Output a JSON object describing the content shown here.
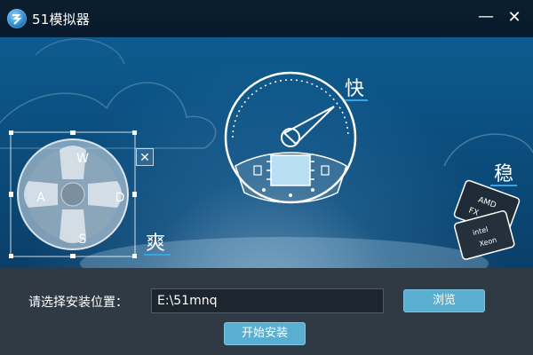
{
  "window": {
    "title": "51模拟器",
    "minimize_glyph": "—",
    "close_glyph": "✕"
  },
  "banner": {
    "feature_fast": "快",
    "feature_stable": "稳",
    "feature_cool": "爽",
    "dpad": {
      "up": "W",
      "left": "A",
      "right": "D",
      "down": "S",
      "close_glyph": "✕"
    },
    "chip_labels": [
      "AMD",
      "FX",
      "intel",
      "Xeon"
    ]
  },
  "install": {
    "path_label": "请选择安装位置：",
    "path_value": "E:\\51mnq",
    "browse_label": "浏览",
    "start_label": "开始安装"
  },
  "colors": {
    "titlebar": "#07192a",
    "banner_top": "#0e5b8f",
    "panel": "#2f3a44",
    "accent": "#3aa3e3",
    "button": "#5aaed0"
  },
  "icons": [
    "app-logo-icon",
    "speedometer-icon",
    "chip-icon",
    "dpad-icon",
    "processor-cards-icon"
  ]
}
